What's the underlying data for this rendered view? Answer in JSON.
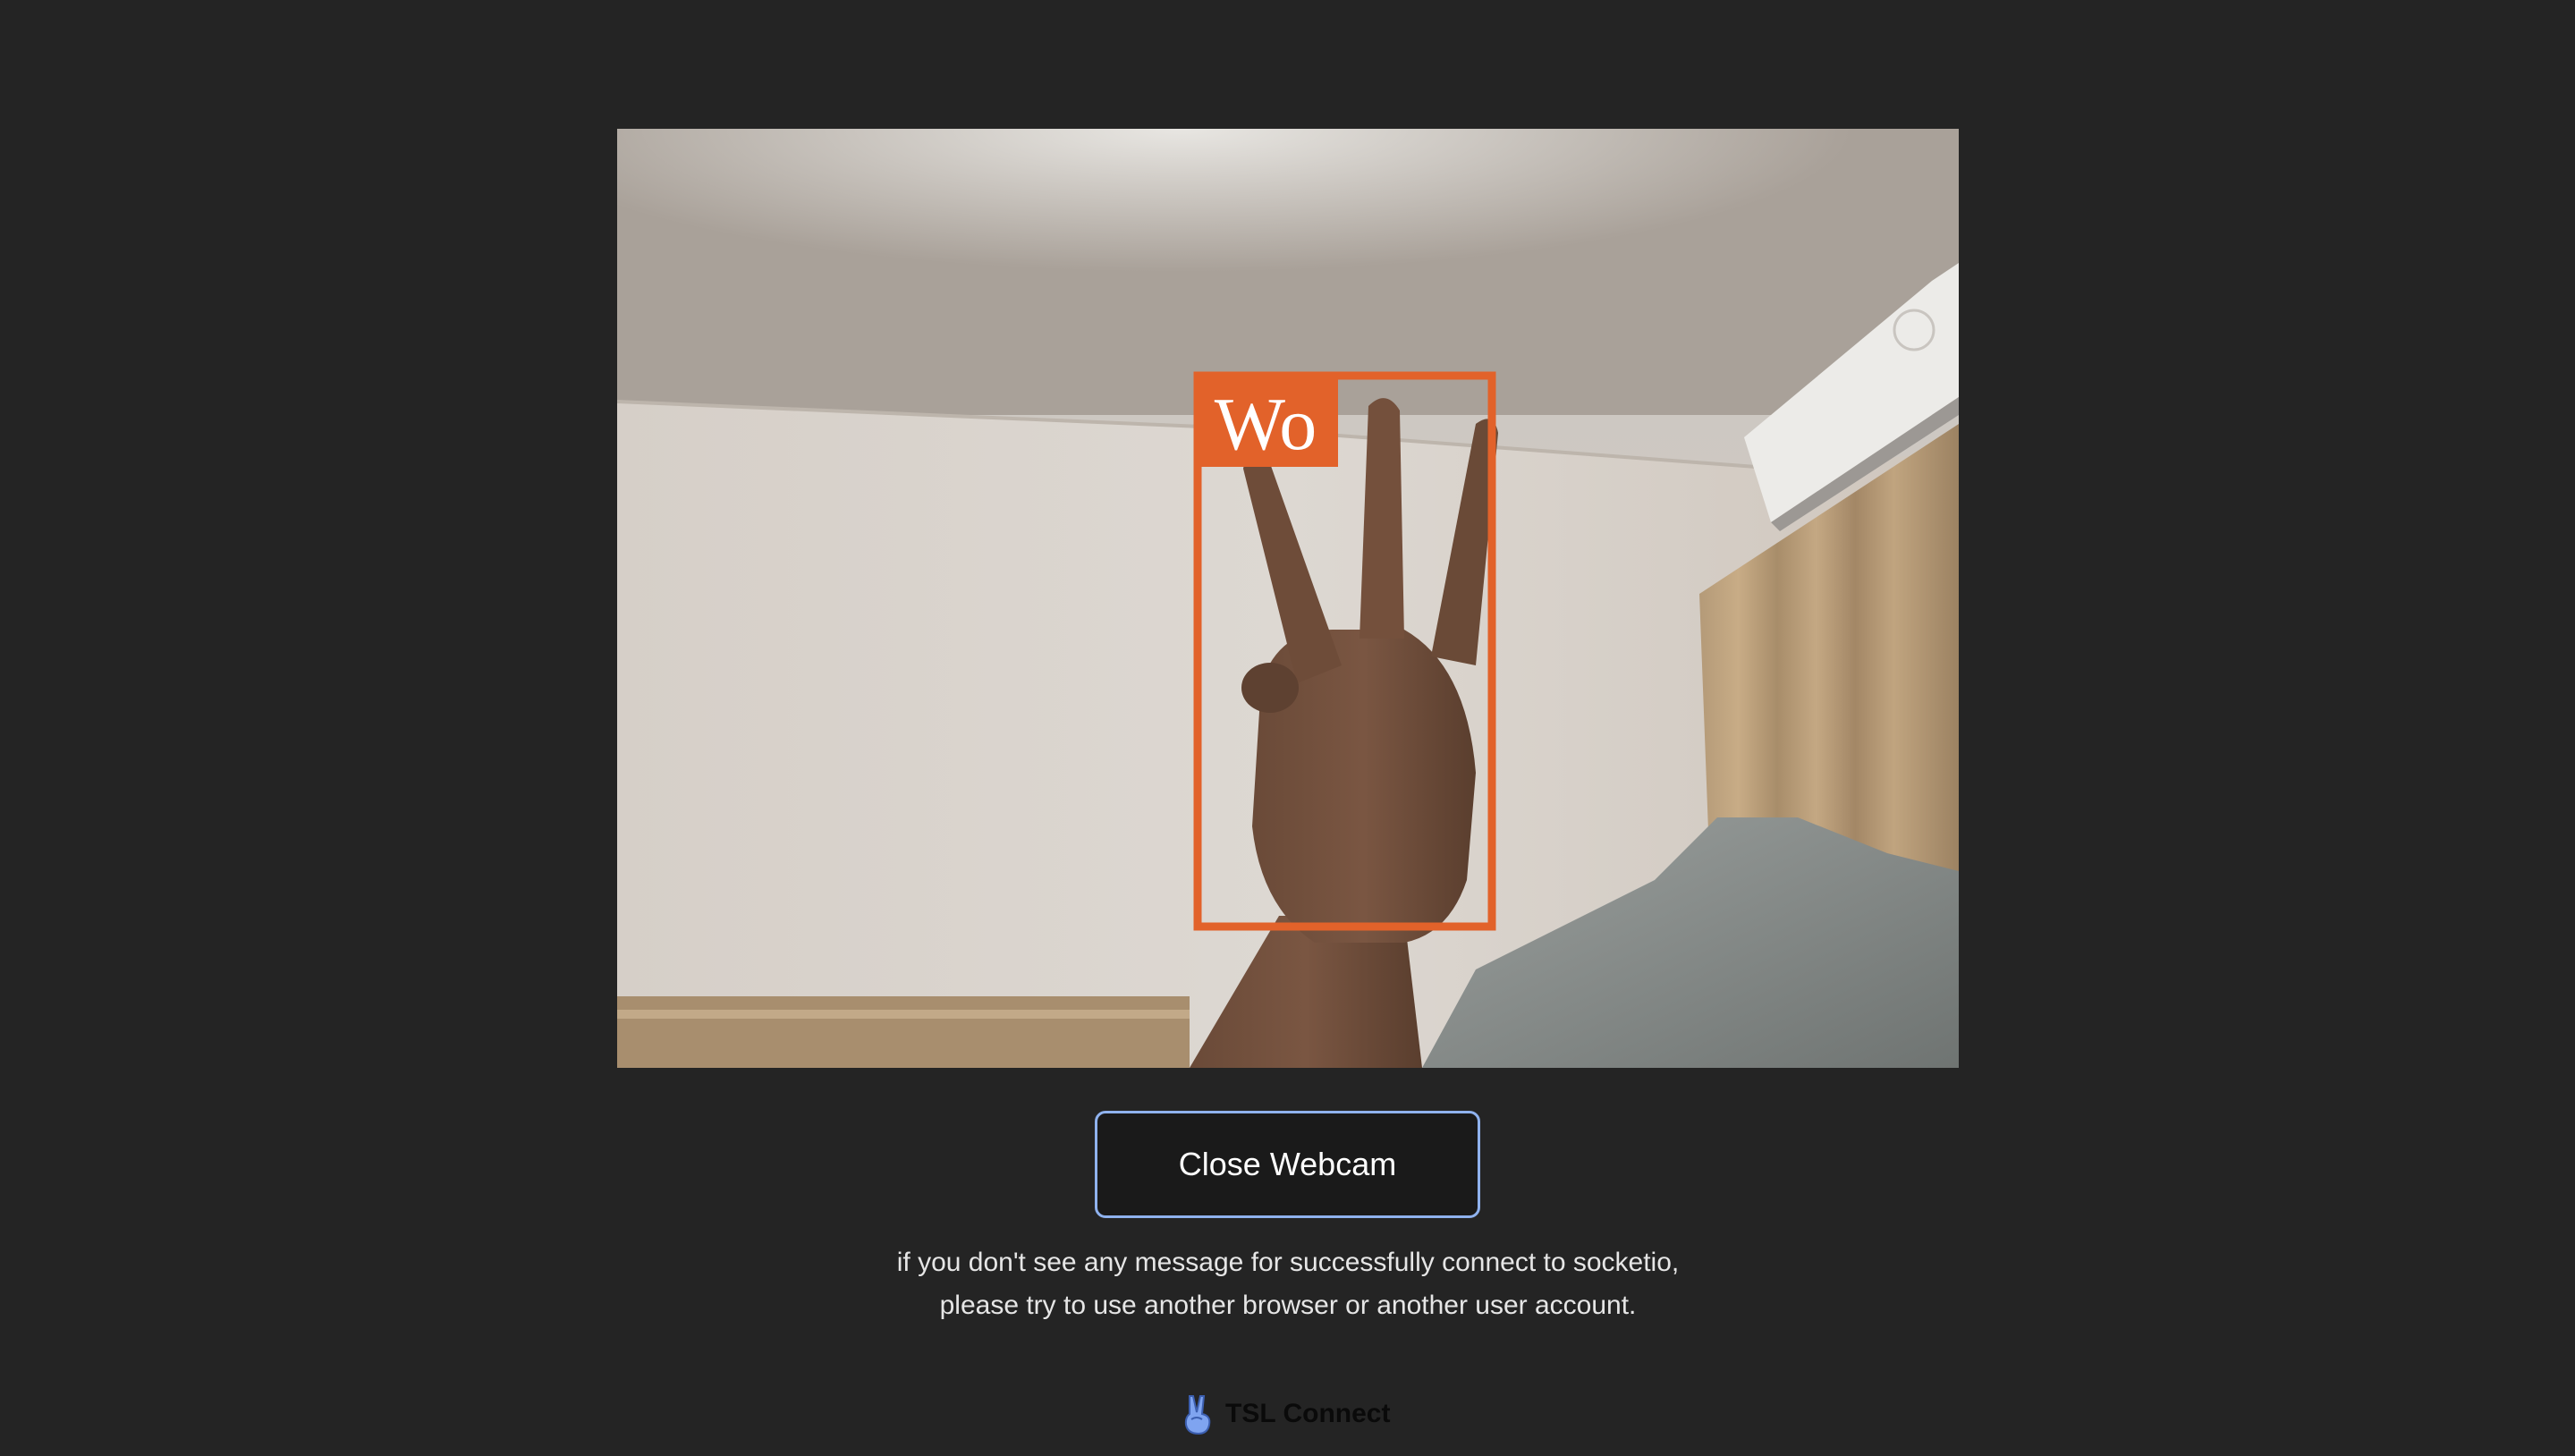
{
  "webcam": {
    "detection_label": "Wo",
    "accent_color": "#e2622a"
  },
  "controls": {
    "close_webcam_label": "Close Webcam"
  },
  "notice": {
    "line1": "if you don't see any message for successfully connect to socketio,",
    "line2": "please try to use another browser or another user account."
  },
  "footer": {
    "brand_icon": "victory-hand-icon",
    "brand_name": "TSL Connect"
  }
}
